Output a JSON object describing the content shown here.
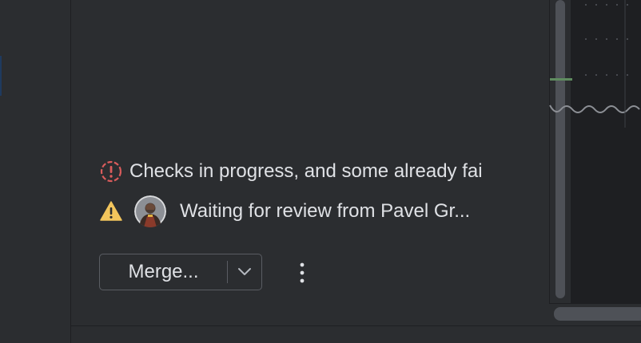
{
  "status": {
    "checks": {
      "icon": "error-circle-icon",
      "icon_color": "#db5c5c",
      "text": "Checks in progress, and some already fai"
    },
    "review": {
      "icon": "warning-triangle-icon",
      "icon_color": "#f2c55c",
      "avatar": "reviewer-avatar",
      "text": "Waiting for review from Pavel Gr..."
    }
  },
  "actions": {
    "merge_label": "Merge...",
    "dropdown_icon": "chevron-down-icon",
    "more_icon": "more-vertical-icon"
  },
  "colors": {
    "background": "#2b2d30",
    "text": "#dfe1e5",
    "border": "#5a5d63",
    "editor_bg": "#1e1f22",
    "diff_marker": "#5f8c5f"
  }
}
